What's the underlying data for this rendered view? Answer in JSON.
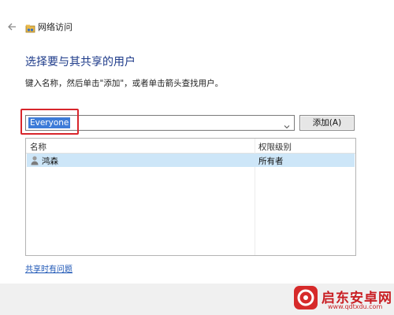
{
  "window": {
    "title": "网络访问",
    "back_icon": "back-arrow-icon",
    "app_icon": "network-share-icon"
  },
  "main": {
    "heading": "选择要与其共享的用户",
    "instruction": "键入名称，然后单击\"添加\"，或者单击箭头查找用户。",
    "name_input": {
      "value": "Everyone"
    },
    "add_button_label": "添加(A)"
  },
  "table": {
    "columns": [
      "名称",
      "权限级别"
    ],
    "rows": [
      {
        "name": "鸿森",
        "permission": "所有者",
        "selected": true,
        "icon": "user-icon"
      }
    ]
  },
  "footer": {
    "trouble_link": "共享时有问题"
  },
  "watermark": {
    "brand": "启东安卓网",
    "url": "www.qdtxdu.com"
  },
  "colors": {
    "accent": "#3d7bd8",
    "heading": "#1e3b8a",
    "selection": "#cde6f8",
    "highlight_box": "#d8262c"
  }
}
